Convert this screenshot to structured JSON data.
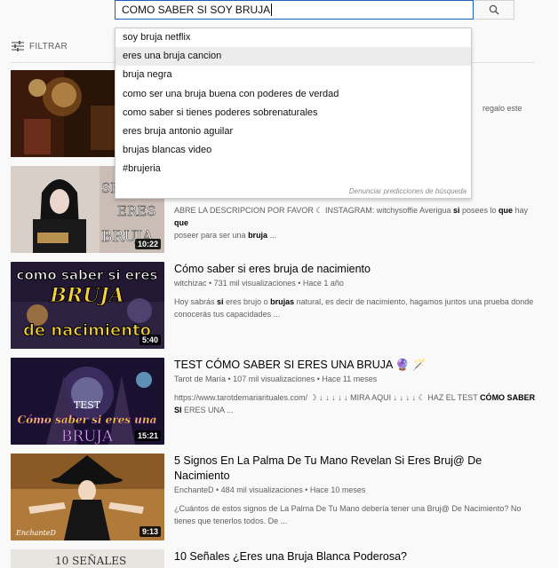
{
  "search": {
    "query": "COMO SABER SI SOY BRUJA"
  },
  "filter": {
    "label": "FILTRAR"
  },
  "suggestions": [
    "soy bruja netflix",
    "eres una bruja cancion",
    "bruja negra",
    "como ser una bruja buena con poderes de verdad",
    "como saber si tienes poderes sobrenaturales",
    "eres bruja antonio aguilar",
    "brujas blancas video",
    "#brujeria"
  ],
  "report_predictions": "Denunciar predicciones de búsqueda",
  "results": [
    {
      "title": "",
      "meta": "",
      "desc_tail": "regalo este",
      "duration": ""
    },
    {
      "title": "",
      "meta": "",
      "desc_line1_a": "ABRE LA DESCRIPCION POR FAVOR ☾ INSTAGRAM: witchysoffie Averigua ",
      "desc_line1_b": "si",
      "desc_line1_c": " posees lo ",
      "desc_line1_d": "que",
      "desc_line1_e": " hay ",
      "desc_line1_f": "que",
      "desc_line2_a": "poseer para ser una ",
      "desc_line2_b": "bruja",
      "desc_line2_c": " ...",
      "duration": "10:22",
      "thumb_text": [
        "SE",
        "ERES",
        "BRUJA"
      ]
    },
    {
      "title": "Cómo saber si eres bruja de nacimiento",
      "meta": "witchizac • 731 mil visualizaciones • Hace 1 año",
      "desc_a": "Hoy sabrás ",
      "desc_b": "si",
      "desc_c": " eres brujo o ",
      "desc_d": "brujas",
      "desc_e": " natural, es decir de nacimiento, hagamos juntos una prueba donde conocerás tus capacidades ...",
      "duration": "5:40",
      "thumb_text": [
        "como saber si eres",
        "BRUJA",
        "de nacimiento"
      ]
    },
    {
      "title": "TEST CÓMO SABER SI ERES UNA BRUJA 🔮 🪄",
      "meta": "Tarot de María • 107 mil visualizaciones • Hace 11 meses",
      "desc_a": "https://www.tarotdemariarituales.com/ ☽ ↓ ↓ ↓ ↓ ↓ MIRA AQUI ↓ ↓ ↓ ↓ ☾ HAZ EL TEST ",
      "desc_b": "CÓMO SABER SI",
      "desc_c": " ERES UNA ...",
      "duration": "15:21",
      "thumb_text": [
        "TEST",
        "Cómo saber si eres una",
        "BRUJA"
      ]
    },
    {
      "title": "5 Signos En La Palma De Tu Mano Revelan Si Eres Bruj@ De Nacimiento",
      "meta": "EnchanteD • 484 mil visualizaciones • Hace 10 meses",
      "desc": "¿Cuántos de estos signos de La Palma De Tu Mano debería tener una Bruj@ De Nacimiento? No tienes que tenerlos todos. De ...",
      "duration": "9:13",
      "thumb_text": [
        "EnchanteD"
      ]
    },
    {
      "title": "10 Señales ¿Eres una Bruja Blanca Poderosa?",
      "thumb_text": [
        "10 SEÑALES"
      ]
    }
  ]
}
